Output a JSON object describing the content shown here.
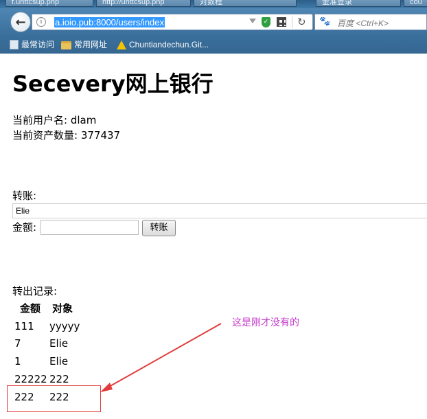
{
  "browser": {
    "tabs": [
      "f.uhttcsup.php",
      "http://uhttcsup.php",
      "对数程",
      "金准登录",
      "cou"
    ],
    "url": "a.ioio.pub:8000/users/index",
    "search_placeholder": "百度 <Ctrl+K>",
    "bookmarks": [
      "最常访问",
      "常用网址",
      "Chuntiandechun.Git..."
    ]
  },
  "page": {
    "title": "Secevery网上银行",
    "username_line": "当前用户名: dlam",
    "balance_line": "当前资产数量: 377437",
    "transfer_label": "转账:",
    "target_selected": "Elie",
    "amount_label": "金额:",
    "transfer_button": "转账",
    "records_label": "转出记录:",
    "columns": [
      "金额",
      "对象"
    ],
    "records": [
      [
        "111",
        "yyyyy"
      ],
      [
        "7",
        "Elie"
      ],
      [
        "1",
        "Elie"
      ],
      [
        "22222",
        "222"
      ],
      [
        "222",
        "222"
      ]
    ]
  },
  "annotation": {
    "text": "这是刚才没有的",
    "color": "#c33ac9",
    "arrow_color": "#e23b3b"
  }
}
